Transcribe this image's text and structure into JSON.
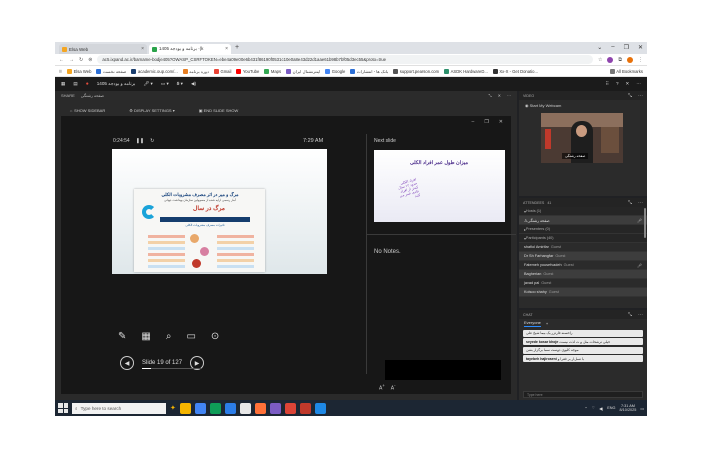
{
  "browser": {
    "tabs": [
      {
        "title": "Elsa Web",
        "favicon_color": "#f4a623"
      },
      {
        "title": "برنامه و بودجه 1405 ·(k",
        "favicon_color": "#2aa34a"
      }
    ],
    "new_tab": "+",
    "window_controls": [
      "⌄",
      "–",
      "❐",
      "✕"
    ],
    "url": "ac5.ixpand.ac.ir/barname-bodje405?OWASP_CSRFTOKEN=ebe4a09e00e6b431f86190f0531c10e0a8e43d22d1aae61b98b7bf05d3ec55&proto=true",
    "bookmarks": [
      {
        "label": "Elsa Web",
        "color": "#f4a623"
      },
      {
        "label": "صفحه نخست",
        "color": "#2c6fd6"
      },
      {
        "label": "academic.oup.com/...",
        "color": "#1a3e6e"
      },
      {
        "label": "دوره برنامه",
        "color": "#e67e22"
      },
      {
        "label": "Gmail",
        "color": "#ea4335"
      },
      {
        "label": "YouTube",
        "color": "#ff0000"
      },
      {
        "label": "Maps",
        "color": "#34a853"
      },
      {
        "label": "اینترنشنال ایران",
        "color": "#7b5cc4"
      },
      {
        "label": "Google",
        "color": "#4285f4"
      },
      {
        "label": "بانک ها - انتشارات",
        "color": "#2c6fd6"
      },
      {
        "label": "support.pearson.com",
        "color": "#555555"
      },
      {
        "label": "ASDK HardwareD...",
        "color": "#2c8f6b"
      },
      {
        "label": "Xx-X - Get Donatio...",
        "color": "#333333"
      }
    ],
    "all_bookmarks": "All Bookmarks"
  },
  "meeting": {
    "title": "برنامه و بودجه 1405",
    "share_label": "SHARE",
    "share_pod_title": "صفحه رشتگی",
    "share_tools": [
      "SHOW SIDEBAR",
      "DISPLAY SETTINGS ▾",
      "END SLIDE SHOW"
    ],
    "timer": "0:24:54",
    "clock": "7:29 AM",
    "next_slide_label": "Next slide",
    "notes": "No Notes.",
    "slide_counter": "Slide 19 of 127",
    "slide": {
      "title": "مرگ و میر در اثر مصرف مشروبات الکلی",
      "subtitle": "آمار رسمی ارایه شده از مسوولین سازمان بهداشت جهانی",
      "banner": "مرگ در سال",
      "band_text": "تاثیرات مصرف مشروبات الکلی"
    },
    "next_slide": {
      "title": "میزان طول عمر افراد الکلی",
      "note": "افراد الکلی حدود ۱۲ سال کمتر از افراد عادی عمر می کنند"
    },
    "video_pod_title": "VIDEO",
    "start_webcam": "Start My Webcam",
    "video_name": "صفحه رشتگی",
    "attendees_title": "ATTENDEES",
    "attendee_count": "41",
    "attendees": [
      {
        "name": "Hosts (1)",
        "section": true
      },
      {
        "name": "صفحه رشتگی",
        "guest": "",
        "mic": true
      },
      {
        "name": "Presenters (0)",
        "section": true
      },
      {
        "name": "Participants (40)",
        "section": true
      },
      {
        "name": "shafiol Amirifar",
        "guest": "Guest",
        "mic": false
      },
      {
        "name": "Dr Sh Farhangfar",
        "guest": "Guest",
        "mic": false
      },
      {
        "name": "Fatemeh yousefvadeh",
        "guest": "Guest",
        "mic": true
      },
      {
        "name": "Bagherian",
        "guest": "Guest",
        "mic": false
      },
      {
        "name": "javad pal",
        "guest": "Guest",
        "mic": false
      },
      {
        "name": "Kolsoo shahy",
        "guest": "Guest",
        "mic": false
      }
    ],
    "chat_title": "CHAT",
    "chat_tab": "Everyone",
    "chat_messages": [
      {
        "sender": "",
        "text": "راحسنه فارتزر یک بیما شیخ علی"
      },
      {
        "sender": "seyede kosar khoje",
        "text": "خیلی ترشحات مثل و ت لذت نیست"
      },
      {
        "sender": "",
        "text": "موجه کلیوی دوست سما برگزار بشن"
      },
      {
        "sender": "tayebeh hajiroseni",
        "text": "با تسل‌ار بر فقرا و"
      }
    ],
    "chat_placeholder": "Type here"
  },
  "taskbar": {
    "search_placeholder": "Type here to search",
    "apps": [
      "#f4b400",
      "#4285f4",
      "#0f9d58",
      "#2b7de9",
      "#e8e8e8",
      "#ff7139",
      "#7b5cc4",
      "#db4437",
      "#c0392b",
      "#1e88e5"
    ],
    "lang": "ENG",
    "time": "7:31 AM",
    "date": "8/10/2025"
  }
}
